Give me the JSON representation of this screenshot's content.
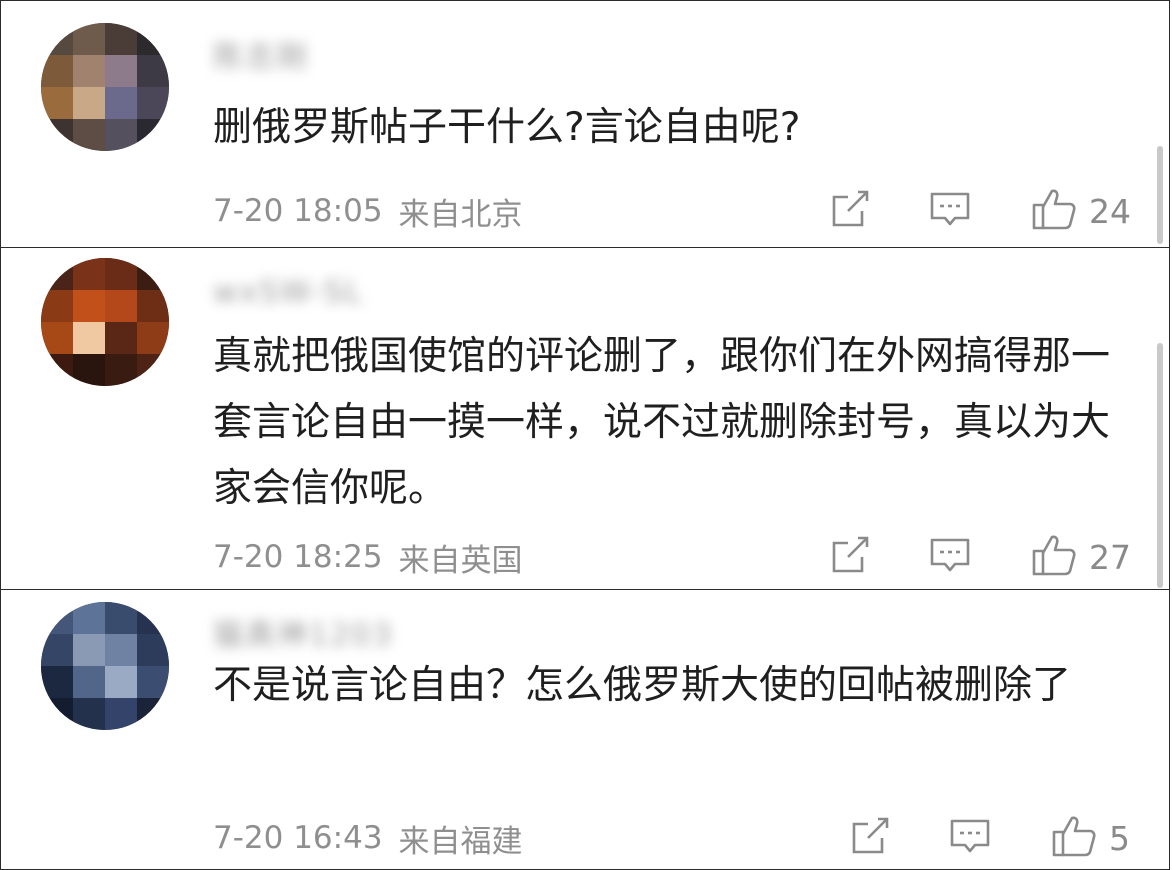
{
  "colors": {
    "text_primary": "#1f1f1f",
    "text_secondary": "#8f8f8f",
    "icon": "#8a8a8a",
    "border": "#2b2b2b"
  },
  "comments": [
    {
      "username": "陈志刚",
      "text": "删俄罗斯帖子干什么?言论自由呢?",
      "time": "7-20 18:05",
      "location": "来自北京",
      "likes": "24",
      "icons": {
        "share": "share-icon",
        "comment": "comment-icon",
        "like": "thumbs-up-icon"
      }
    },
    {
      "username": "wxSW-SL",
      "text": "真就把俄国使馆的评论删了，跟你们在外网搞得那一套言论自由一摸一样，说不过就删除封号，真以为大家会信你呢。",
      "time": "7-20 18:25",
      "location": "来自英国",
      "likes": "27",
      "icons": {
        "share": "share-icon",
        "comment": "comment-icon",
        "like": "thumbs-up-icon"
      }
    },
    {
      "username": "猫真神1203",
      "text": "不是说言论自由？怎么俄罗斯大使的回帖被删除了",
      "time": "7-20 16:43",
      "location": "来自福建",
      "likes": "5",
      "icons": {
        "share": "share-icon",
        "comment": "comment-icon",
        "like": "thumbs-up-icon"
      }
    }
  ]
}
